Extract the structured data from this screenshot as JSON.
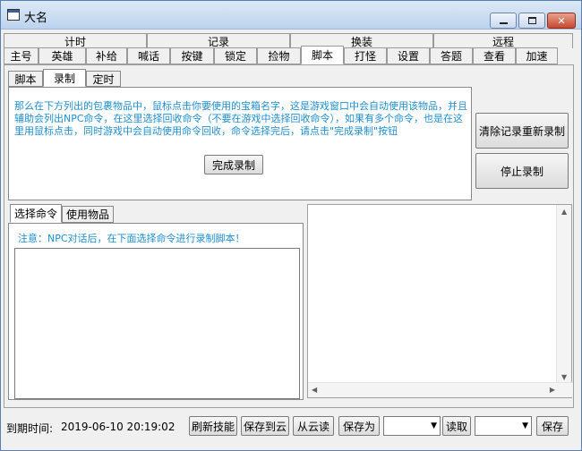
{
  "window": {
    "title": "大名"
  },
  "group_tabs": [
    "计时",
    "记录",
    "换装",
    "远程"
  ],
  "main_tabs": [
    "主号",
    "英雄",
    "补给",
    "喊话",
    "按键",
    "锁定",
    "捡物",
    "脚本",
    "打怪",
    "设置",
    "答题",
    "查看",
    "加速"
  ],
  "main_tab_active": "脚本",
  "sub_tabs": [
    "脚本",
    "录制",
    "定时"
  ],
  "sub_tab_active": "录制",
  "info": {
    "text": "那么在下方列出的包裹物品中，鼠标点击你要使用的宝箱名字，这是游戏窗口中会自动使用该物品，并且辅助会列出NPC命令，在这里选择回收命令（不要在游戏中选择回收命令），如果有多个命令，也是在这里用鼠标点击，同时游戏中会自动使用命令回收，命令选择完后，请点击\"完成录制\"按钮",
    "finish_button": "完成录制"
  },
  "side_buttons": {
    "clear_restart": "清除记录重新录制",
    "stop": "停止录制"
  },
  "cmd_tabs": [
    "选择命令",
    "使用物品"
  ],
  "cmd_tab_active": "选择命令",
  "cmd_notice": "注意：NPC对话后，在下面选择命令进行录制脚本！",
  "status": {
    "expire_label": "到期时间:",
    "expire_value": "2019-06-10 20:19:02",
    "buttons": {
      "refresh": "刷新技能",
      "save_cloud": "保存到云",
      "from_cloud": "从云读",
      "save_as": "保存为",
      "read": "读取",
      "save": "保存"
    },
    "combo1_value": "",
    "combo2_value": ""
  },
  "icons": {
    "minimize": "minimize-icon",
    "maximize": "maximize-icon",
    "close": "close-icon",
    "app": "window-icon"
  }
}
